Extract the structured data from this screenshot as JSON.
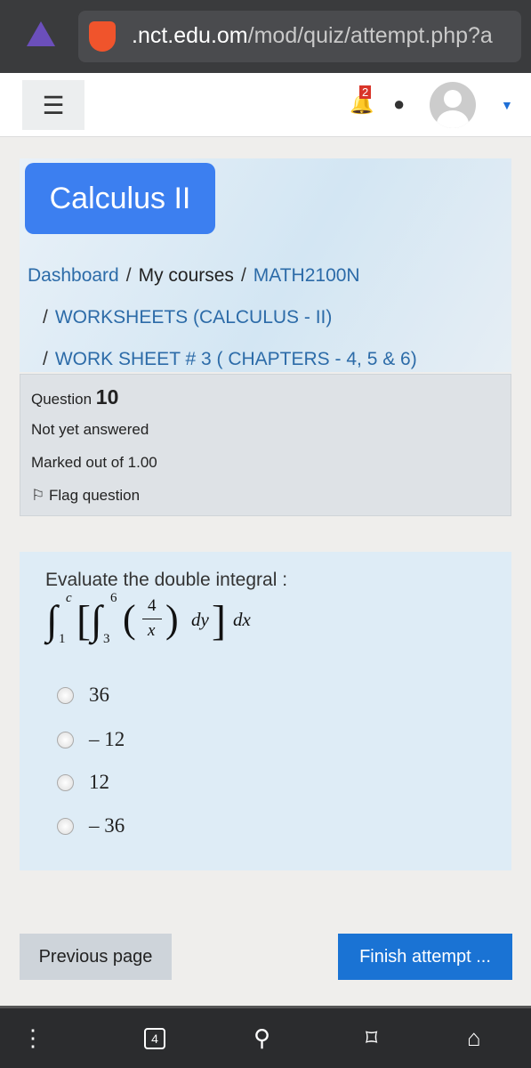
{
  "browser": {
    "url_host": ".nct.edu.om",
    "url_path": "/mod/quiz/attempt.php?a",
    "tab_count": "4"
  },
  "navbar": {
    "notification_count": "2"
  },
  "course": {
    "title": "Calculus II"
  },
  "breadcrumb": [
    "Dashboard",
    "My courses",
    "MATH2100N",
    "WORKSHEETS (CALCULUS - II)",
    "WORK SHEET # 3 ( CHAPTERS - 4, 5 & 6)"
  ],
  "question": {
    "label": "Question",
    "number": "10",
    "status": "Not yet answered",
    "marks": "Marked out of 1.00",
    "flag": "Flag question",
    "prompt": "Evaluate the double integral :",
    "integral": {
      "outer_upper": "c",
      "outer_lower": "1",
      "inner_upper": "6",
      "inner_lower": "3",
      "numerator": "4",
      "denominator": "x",
      "inner_diff": "dy",
      "outer_diff": "dx"
    },
    "options": [
      "36",
      "– 12",
      "12",
      "– 36"
    ]
  },
  "buttons": {
    "previous": "Previous page",
    "finish": "Finish attempt ..."
  }
}
